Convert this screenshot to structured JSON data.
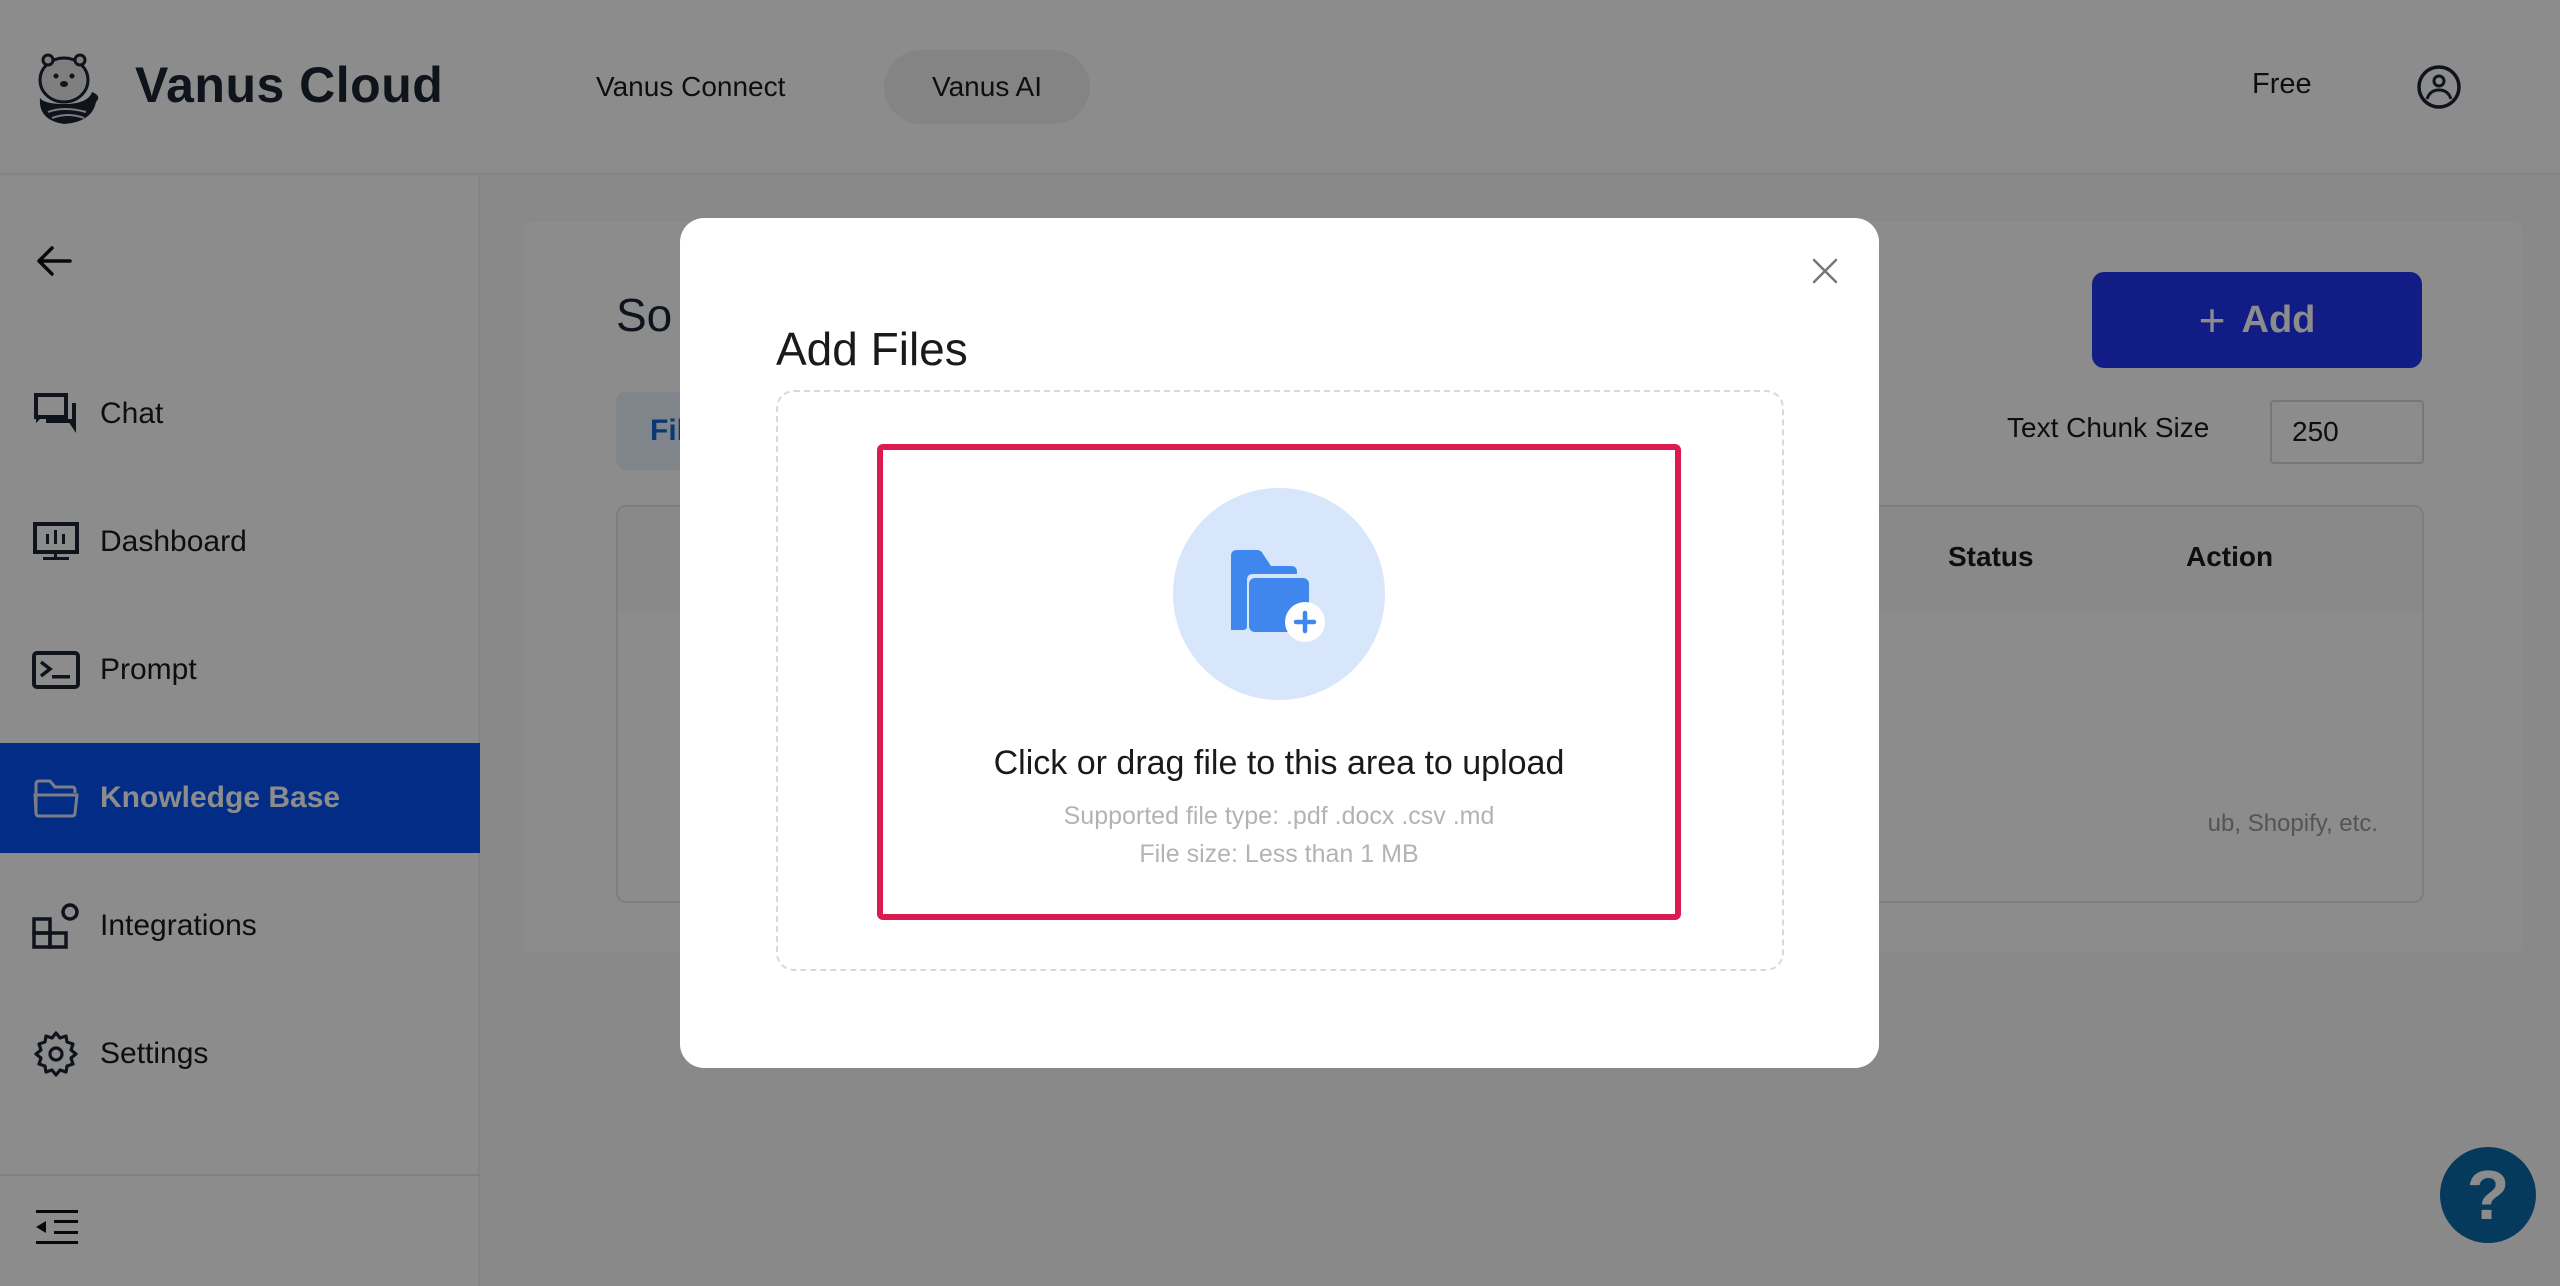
{
  "header": {
    "brand": "Vanus Cloud",
    "nav": [
      {
        "label": "Vanus Connect",
        "active": false
      },
      {
        "label": "Vanus AI",
        "active": true
      }
    ],
    "plan": "Free",
    "icons": {
      "logo": "otter-logo",
      "user": "user-circle-icon"
    }
  },
  "sidebar": {
    "back_icon": "arrow-left-icon",
    "items": [
      {
        "label": "Chat",
        "icon": "chat-icon",
        "active": false
      },
      {
        "label": "Dashboard",
        "icon": "dashboard-icon",
        "active": false
      },
      {
        "label": "Prompt",
        "icon": "terminal-icon",
        "active": false
      },
      {
        "label": "Knowledge Base",
        "icon": "folder-icon",
        "active": true
      },
      {
        "label": "Integrations",
        "icon": "integrations-icon",
        "active": false
      },
      {
        "label": "Settings",
        "icon": "gear-icon",
        "active": false
      }
    ],
    "collapse_icon": "collapse-menu-icon",
    "active_color": "#0650f5"
  },
  "main": {
    "title_partial": "So",
    "tab_partial": "Fil",
    "add_button": {
      "plus": "+",
      "label": "Add"
    },
    "text_chunk": {
      "label": "Text Chunk Size",
      "value": "250"
    },
    "table": {
      "headers": [
        "Status",
        "Action"
      ],
      "empty_hint_partial": "ub, Shopify, etc."
    }
  },
  "help": {
    "label": "?"
  },
  "modal": {
    "title": "Add Files",
    "close_icon": "close-icon",
    "upload": {
      "icon": "folder-add-icon",
      "main_text": "Click or drag file to this area to upload",
      "supported_types": "Supported file type: .pdf .docx .csv .md",
      "size_limit": "File size: Less than 1 MB"
    },
    "highlight_color": "#dc1a4f"
  }
}
